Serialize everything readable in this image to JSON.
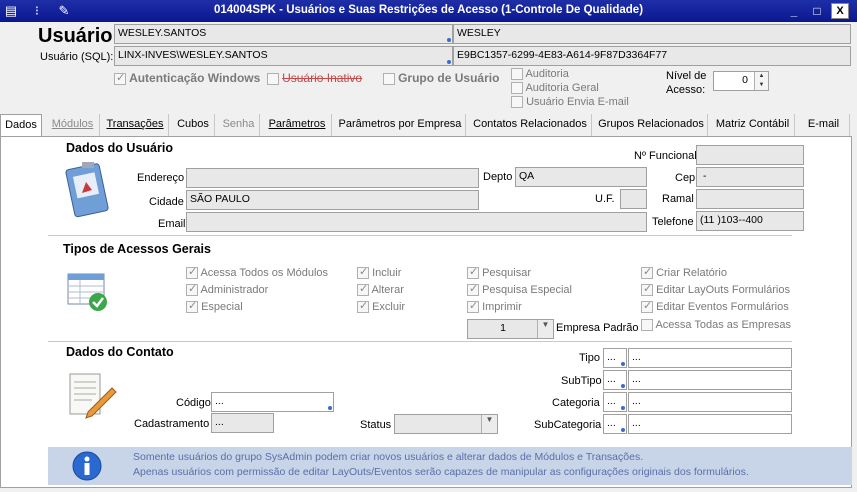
{
  "window": {
    "title": "014004SPK - Usuários e Suas Restrições de Acesso (1-Controle De Qualidade)",
    "controls": {
      "minimize": "_",
      "maximize": "□",
      "close": "X"
    }
  },
  "header": {
    "usuario_label": "Usuário",
    "usuario_sql_label": "Usuário (SQL):",
    "usuario_value": "WESLEY.SANTOS",
    "nome_value": "WESLEY",
    "usuario_sql_value": "LINX-INVES\\WESLEY.SANTOS",
    "guid_value": "E9BC1357-6299-4E83-A614-9F87D3364F77",
    "autenticacao_windows": "Autenticação Windows",
    "usuario_inativo": "Usuário Inativo",
    "grupo_de_usuario": "Grupo de Usuário",
    "auditoria": "Auditoria",
    "auditoria_geral": "Auditoria Geral",
    "usuario_envia_email": "Usuário Envia E-mail",
    "nivel_label_1": "Nível de",
    "nivel_label_2": "Acesso:",
    "nivel_value": "0"
  },
  "tabs": [
    {
      "label": "Dados"
    },
    {
      "label": "Módulos"
    },
    {
      "label": "Transações"
    },
    {
      "label": "Cubos"
    },
    {
      "label": "Senha"
    },
    {
      "label": "Parâmetros"
    },
    {
      "label": "Parâmetros por Empresa"
    },
    {
      "label": "Contatos Relacionados"
    },
    {
      "label": "Grupos Relacionados"
    },
    {
      "label": "Matriz Contábil"
    },
    {
      "label": "E-mail"
    }
  ],
  "dados_usuario": {
    "title": "Dados do Usuário",
    "n_funcional_label": "Nº Funcional",
    "n_funcional_value": "",
    "endereco_label": "Endereço",
    "endereco_value": "",
    "depto_label": "Depto",
    "depto_value": "QA",
    "cep_label": "Cep",
    "cep_value": "-",
    "cidade_label": "Cidade",
    "cidade_value": "SÃO PAULO",
    "uf_label": "U.F.",
    "uf_value": "",
    "ramal_label": "Ramal",
    "ramal_value": "",
    "email_label": "Email",
    "email_value": "",
    "telefone_label": "Telefone",
    "telefone_value": "(11 )103--400"
  },
  "tipos_acessos": {
    "title": "Tipos de Acessos Gerais",
    "col1": [
      "Acessa Todos os Módulos",
      "Administrador",
      "Especial"
    ],
    "col2": [
      "Incluir",
      "Alterar",
      "Excluir"
    ],
    "col3": [
      "Pesquisar",
      "Pesquisa Especial",
      "Imprimir"
    ],
    "col4": [
      "Criar Relatório",
      "Editar LayOuts Formulários",
      "Editar Eventos Formulários",
      "Acessa Todas as Empresas"
    ],
    "empresa_padrao_value": "1",
    "empresa_padrao_label": "Empresa Padrão"
  },
  "dados_contato": {
    "title": "Dados do Contato",
    "codigo_label": "Código",
    "codigo_value": "...",
    "cadastramento_label": "Cadastramento",
    "cadastramento_value": "...",
    "status_label": "Status",
    "status_value": "",
    "tipo_label": "Tipo",
    "subtipo_label": "SubTipo",
    "categoria_label": "Categoria",
    "subcategoria_label": "SubCategoria",
    "ellipsis": "..."
  },
  "info": {
    "line1": "Somente usuários do grupo SysAdmin podem criar novos usuários e alterar dados de Módulos e Transações.",
    "line2": "Apenas usuários com permissão de editar LayOuts/Eventos serão capazes de manipular as configurações originais dos formulários."
  }
}
